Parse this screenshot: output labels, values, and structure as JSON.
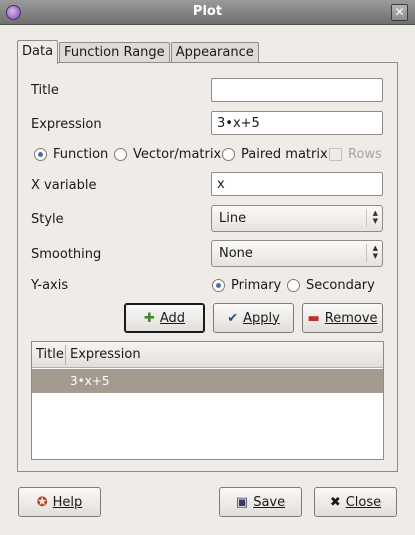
{
  "window": {
    "title": "Plot"
  },
  "tabs": [
    {
      "label": "Data",
      "active": true
    },
    {
      "label": "Function Range",
      "active": false
    },
    {
      "label": "Appearance",
      "active": false
    }
  ],
  "form": {
    "title_label": "Title",
    "title_value": "",
    "expression_label": "Expression",
    "expression_value": "3•x+5",
    "type_function": "Function",
    "type_vector": "Vector/matrix",
    "type_paired": "Paired matrix",
    "rows_label": "Rows",
    "xvar_label": "X variable",
    "xvar_value": "x",
    "style_label": "Style",
    "style_value": "Line",
    "smoothing_label": "Smoothing",
    "smoothing_value": "None",
    "yaxis_label": "Y-axis",
    "yaxis_primary": "Primary",
    "yaxis_secondary": "Secondary"
  },
  "actions": {
    "add": "Add",
    "apply": "Apply",
    "remove": "Remove"
  },
  "table": {
    "columns": [
      "Title",
      "Expression"
    ],
    "rows": [
      {
        "title": "",
        "expression": "3•x+5"
      }
    ]
  },
  "footer": {
    "help": "Help",
    "save": "Save",
    "close": "Close"
  },
  "colors": {
    "selection": "#a59a90",
    "radio_active": "#4a6fa5"
  }
}
